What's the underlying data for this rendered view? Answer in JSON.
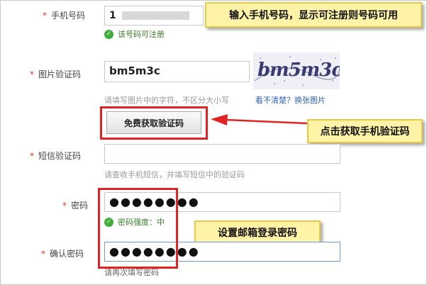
{
  "form": {
    "phone": {
      "label": "手机号码",
      "required_mark": "*",
      "value": "1",
      "status": "该号码可注册"
    },
    "captcha": {
      "label": "图片验证码",
      "required_mark": "*",
      "value": "bm5m3c",
      "image_text": "bm5m3c",
      "hint": "请填写图片中的字符，不区分大小写",
      "refresh_prefix": "看不清楚？",
      "refresh_link": "换张图片"
    },
    "get_code_button": "免费获取验证码",
    "sms": {
      "label": "短信验证码",
      "required_mark": "*",
      "value": "",
      "hint": "请查收手机短信，并填写短信中的验证码"
    },
    "password": {
      "label": "密码",
      "required_mark": "*",
      "masked_value": "●●●●●●●●",
      "strength": "密码强度：中"
    },
    "confirm": {
      "label": "确认密码",
      "required_mark": "*",
      "masked_value": "●●●●●●●●",
      "hint": "请再次填写密码"
    }
  },
  "annotations": {
    "phone_note": "输入手机号码，显示可注册则号码可用",
    "code_note": "点击获取手机验证码",
    "password_note": "设置邮箱登录密码"
  },
  "colors": {
    "highlight": "#e02424",
    "note_bg": "#fff3a8",
    "ok_green": "#3fae3a",
    "link_blue": "#2a62b5"
  }
}
